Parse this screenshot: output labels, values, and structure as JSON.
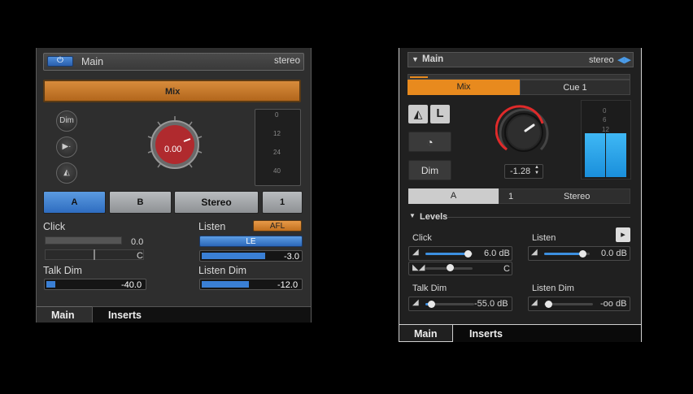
{
  "left": {
    "header": {
      "title": "Main",
      "mode": "stereo"
    },
    "mix_label": "Mix",
    "side_buttons": [
      "Dim"
    ],
    "knob_value": "0.00",
    "meter_ticks": [
      "0",
      "12",
      "24",
      "40"
    ],
    "routing": [
      "A",
      "B",
      "Stereo",
      "1"
    ],
    "click": {
      "label": "Click",
      "level": "0.0",
      "pan": "C"
    },
    "listen": {
      "label": "Listen",
      "mode": "AFL",
      "channel": "LE",
      "level": "-3.0"
    },
    "talk_dim": {
      "label": "Talk Dim",
      "value": "-40.0"
    },
    "listen_dim": {
      "label": "Listen Dim",
      "value": "-12.0"
    },
    "tabs": [
      "Main",
      "Inserts"
    ]
  },
  "right": {
    "header": {
      "title": "Main",
      "mode": "stereo"
    },
    "mix_tabs": [
      "Mix",
      "Cue 1"
    ],
    "dim_label": "Dim",
    "knob_value": "-1.28",
    "meter_ticks": [
      "0",
      "6",
      "12"
    ],
    "routing": [
      "A",
      "1",
      "Stereo"
    ],
    "levels_title": "Levels",
    "click": {
      "label": "Click",
      "level": "6.0 dB",
      "pan": "C"
    },
    "listen": {
      "label": "Listen",
      "level": "0.0 dB"
    },
    "talk_dim": {
      "label": "Talk Dim",
      "value": "-55.0 dB"
    },
    "listen_dim": {
      "label": "Listen Dim",
      "value": "-oo dB"
    },
    "tabs": [
      "Main",
      "Inserts"
    ]
  },
  "colors": {
    "accent_orange": "#e88a1e",
    "accent_blue": "#3c8fe0",
    "knob_red": "#c0282c"
  }
}
